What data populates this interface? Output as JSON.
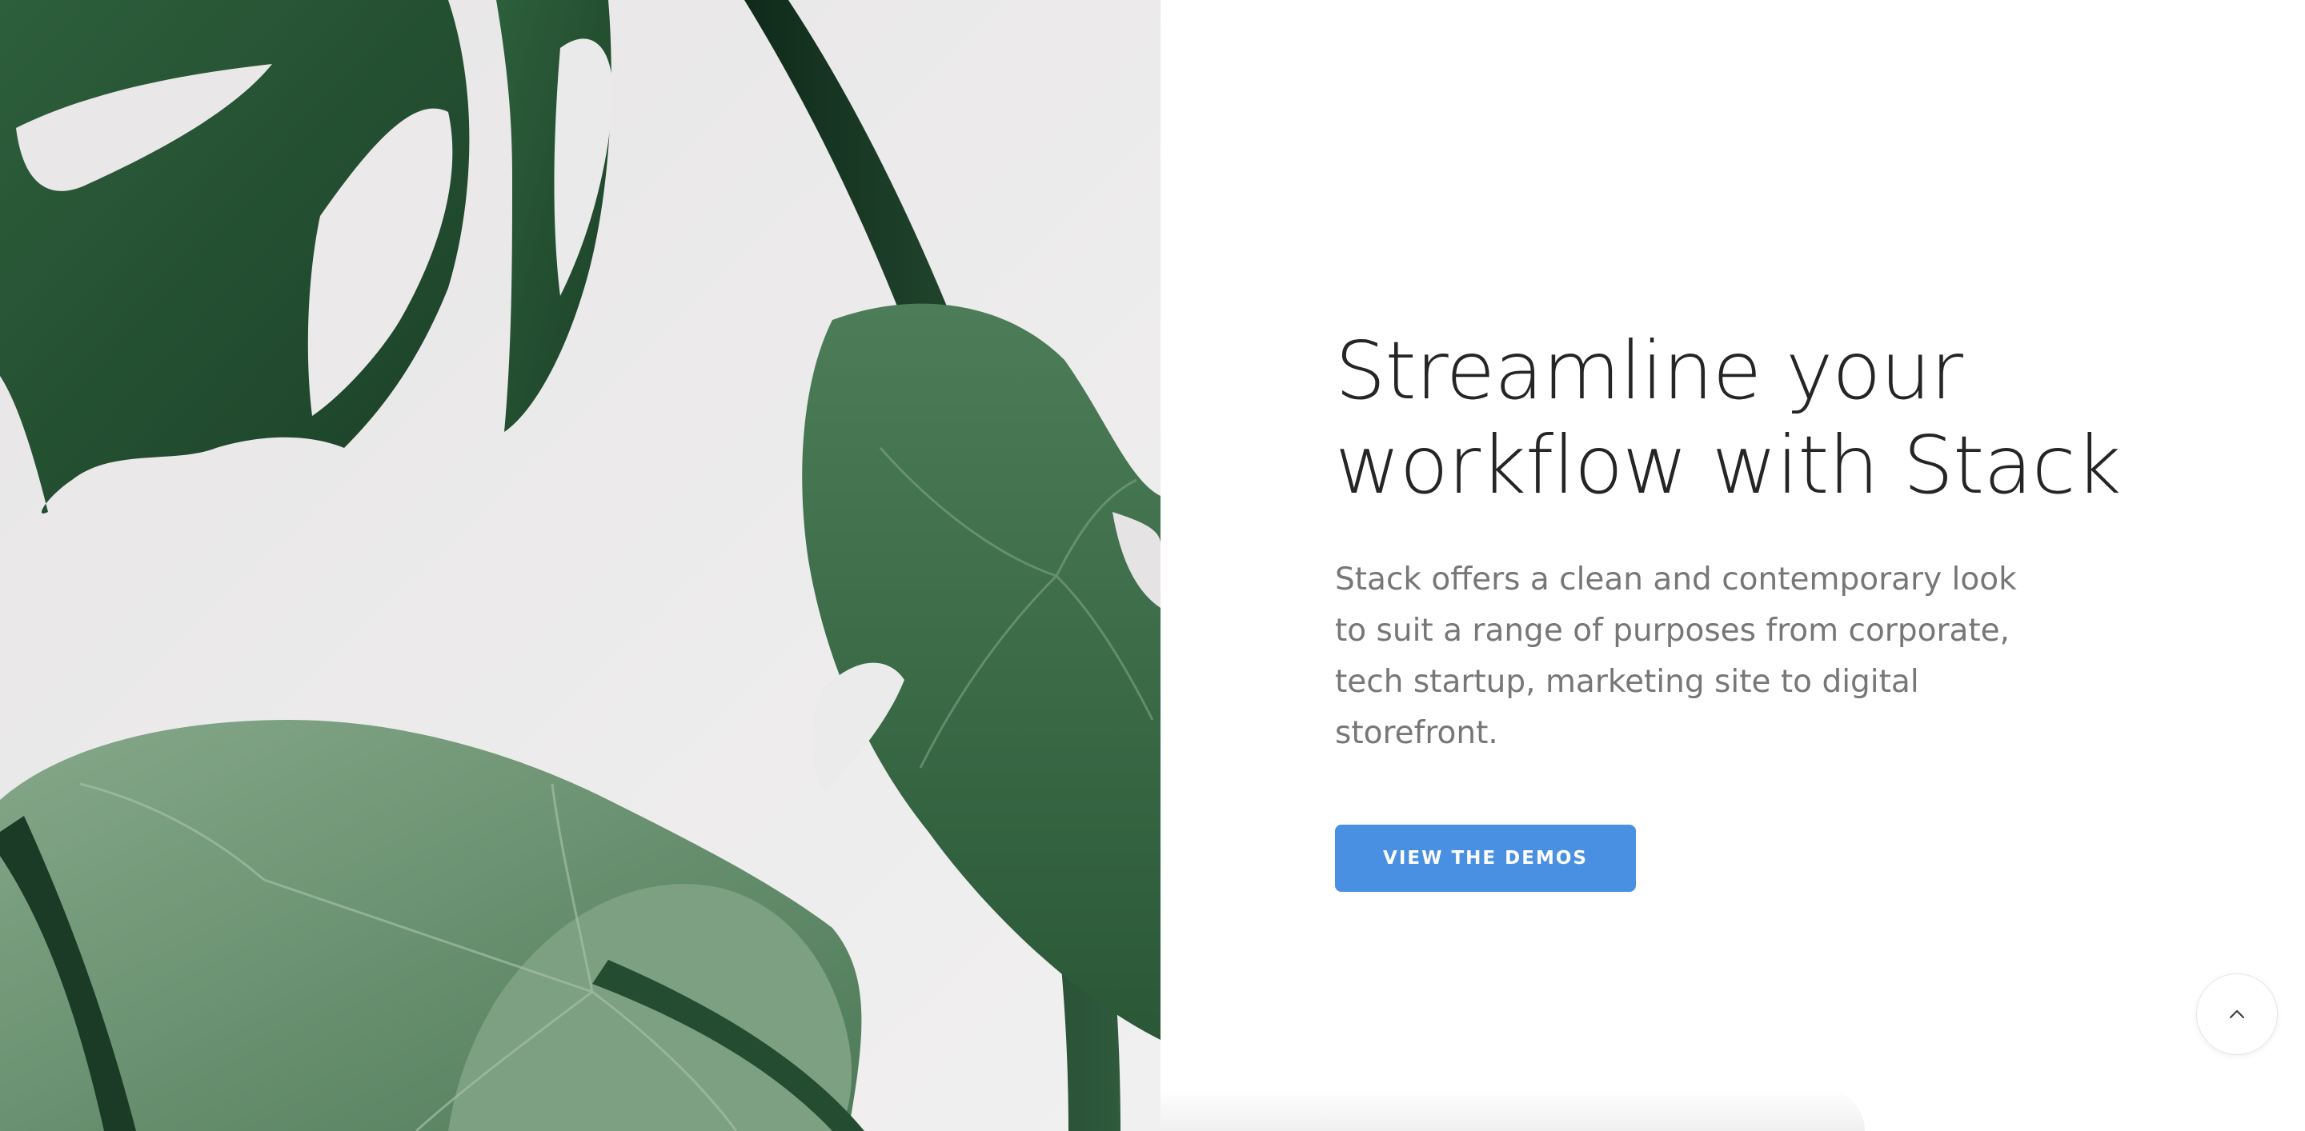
{
  "hero": {
    "image_alt": "monstera-leaves-photo",
    "headline_line1": "Streamline your",
    "headline_line2": "workflow with Stack",
    "description": "Stack offers a clean and contemporary look to suit a range of purposes from corporate, tech startup, marketing site to digital storefront.",
    "cta_label": "VIEW THE DEMOS"
  },
  "back_to_top": {
    "icon": "chevron-up-icon"
  },
  "colors": {
    "accent": "#4a90e2",
    "headline": "#252525",
    "body_text": "#777777",
    "leaf_dark": "#1f4a2e",
    "leaf_mid": "#3c6e4a",
    "leaf_light": "#6f9777",
    "photo_bg": "#eceaea"
  }
}
